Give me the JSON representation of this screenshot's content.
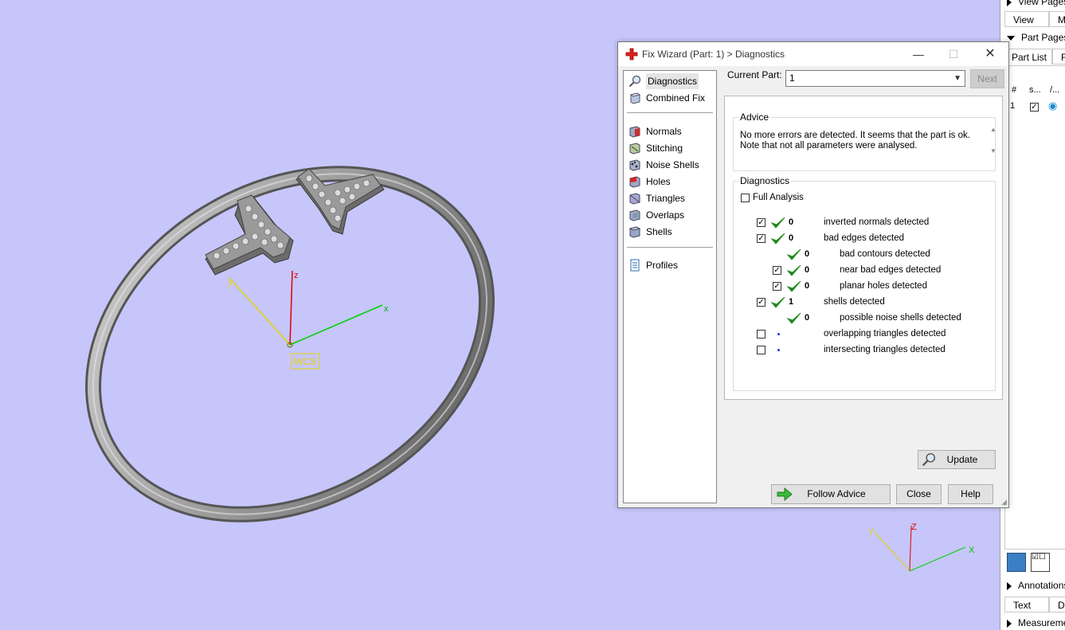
{
  "viewport": {
    "wcs_label": "WCS",
    "axes": {
      "x": "x",
      "y": "y",
      "z": "z"
    },
    "mini_axes": {
      "x": "X",
      "y": "Y",
      "z": "Z"
    },
    "background": "#c6c6fb"
  },
  "side_panel": {
    "view_pages": "View Pages",
    "view_tab": "View",
    "view_tab2": "M",
    "part_pages": "Part Pages",
    "part_list_tab": "Part List",
    "part_list_tab2": "F",
    "columns": [
      "#",
      "s...",
      "/..."
    ],
    "row": {
      "num": "1",
      "visible_icon": "eye-icon",
      "checked": true
    },
    "annotations": "Annotations",
    "text_tab": "Text",
    "text_tab2": "D",
    "measurements": "Measurements"
  },
  "dialog": {
    "title": "Fix Wizard (Part: 1) > Diagnostics",
    "minimize": "—",
    "maximize": "☐",
    "close": "✕",
    "nav": {
      "group1": [
        {
          "label": "Diagnostics",
          "icon": "magnifier-icon",
          "selected": true
        },
        {
          "label": "Combined Fix",
          "icon": "cube-icon",
          "selected": false
        }
      ],
      "group2": [
        {
          "label": "Normals",
          "icon": "normals-icon"
        },
        {
          "label": "Stitching",
          "icon": "stitching-icon"
        },
        {
          "label": "Noise Shells",
          "icon": "noise-shells-icon"
        },
        {
          "label": "Holes",
          "icon": "holes-icon"
        },
        {
          "label": "Triangles",
          "icon": "triangles-icon"
        },
        {
          "label": "Overlaps",
          "icon": "overlaps-icon"
        },
        {
          "label": "Shells",
          "icon": "shells-icon"
        }
      ],
      "group3": [
        {
          "label": "Profiles",
          "icon": "document-icon"
        }
      ]
    },
    "current_part_label": "Current Part:",
    "current_part_value": "1",
    "next_button": "Next",
    "advice": {
      "title": "Advice",
      "line1": "No more errors are detected. It seems that the part is ok.",
      "line2": "Note that not all parameters were analysed."
    },
    "diagnostics": {
      "title": "Diagnostics",
      "full_analysis_label": "Full Analysis",
      "full_analysis_checked": false,
      "rows": [
        {
          "label": "inverted normals detected",
          "count": "0",
          "checkbox": true,
          "checked": true,
          "status": "check",
          "indent": 0
        },
        {
          "label": "bad edges detected",
          "count": "0",
          "checkbox": true,
          "checked": true,
          "status": "check",
          "indent": 0
        },
        {
          "label": "bad contours detected",
          "count": "0",
          "checkbox": false,
          "checked": false,
          "status": "check",
          "indent": 1
        },
        {
          "label": "near bad edges detected",
          "count": "0",
          "checkbox": true,
          "checked": true,
          "status": "check",
          "indent": 1
        },
        {
          "label": "planar holes detected",
          "count": "0",
          "checkbox": true,
          "checked": true,
          "status": "check",
          "indent": 1
        },
        {
          "label": "shells detected",
          "count": "1",
          "checkbox": true,
          "checked": true,
          "status": "check",
          "indent": 0
        },
        {
          "label": "possible noise shells detected",
          "count": "0",
          "checkbox": false,
          "checked": false,
          "status": "check",
          "indent": 1
        },
        {
          "label": "overlapping triangles detected",
          "count": "",
          "checkbox": true,
          "checked": false,
          "status": "dot",
          "indent": 0
        },
        {
          "label": "intersecting triangles detected",
          "count": "",
          "checkbox": true,
          "checked": false,
          "status": "dot",
          "indent": 0
        }
      ],
      "update_button": "Update"
    },
    "follow_advice_button": "Follow Advice",
    "close_button": "Close",
    "help_button": "Help",
    "colors": {
      "check_green": "#1f8a1f",
      "arrow_green": "#3cb83c",
      "accent_red": "#e02020"
    }
  }
}
